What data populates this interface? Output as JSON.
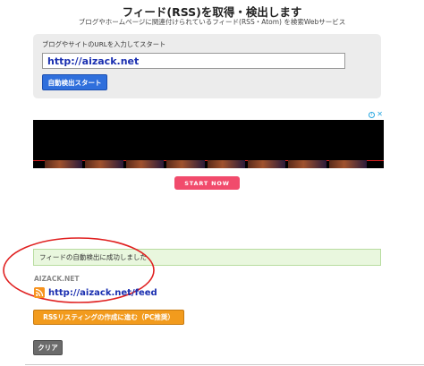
{
  "header": {
    "title": "フィード(RSS)を取得・検出します",
    "subtitle": "ブログやホームページに関連付けられているフィード(RSS・Atom) を検索Webサービス"
  },
  "search": {
    "label": "ブログやサイトのURLを入力してスタート",
    "value": "http://aizack.net",
    "button_label": "自動検出スタート"
  },
  "ad": {
    "start_button_label": "START NOW",
    "info_icon": "info-icon",
    "close_icon": "close-icon"
  },
  "result": {
    "success_message": "フィードの自動検出に成功しました",
    "site_name": "AIZACK.NET",
    "feed_url": "http://aizack.net/feed",
    "feed_icon": "rss-icon"
  },
  "actions": {
    "listing_button_label": "RSSリスティングの作成に進む（PC推奨）",
    "clear_button_label": "クリア"
  },
  "colors": {
    "accent_blue": "#2f6fdc",
    "link_blue": "#1a2fb0",
    "orange": "#f29b1d",
    "success_bg": "#e9f7de",
    "annotation_red": "#e02020",
    "start_pink": "#f14b6c"
  }
}
